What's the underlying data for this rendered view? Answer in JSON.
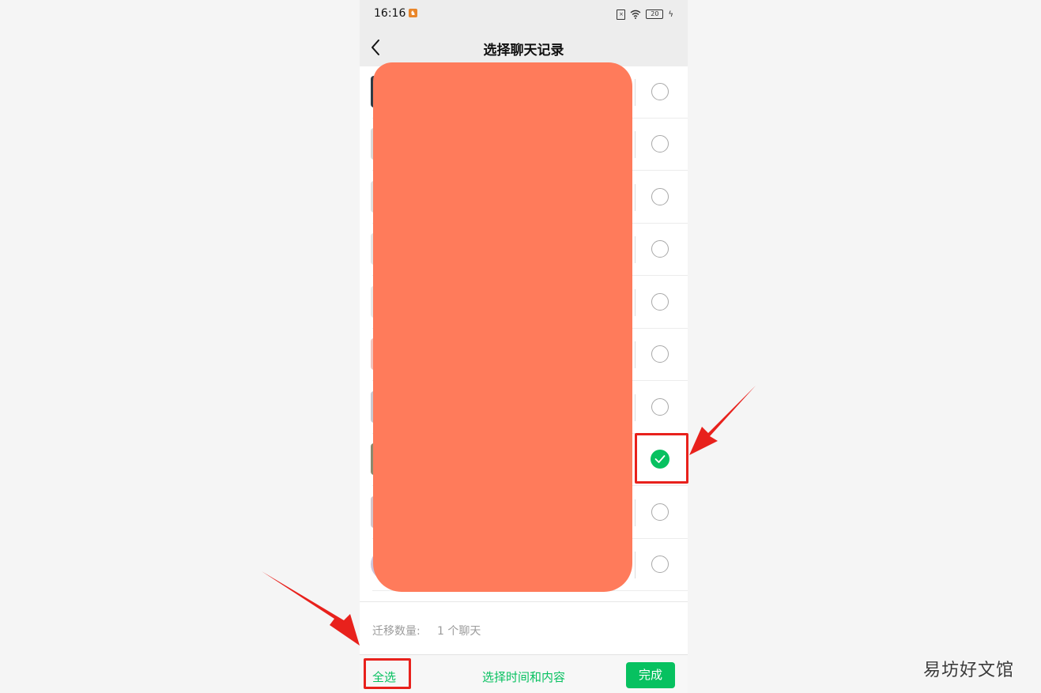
{
  "status_bar": {
    "time": "16:16",
    "battery": "20"
  },
  "header": {
    "title": "选择聊天记录"
  },
  "list": {
    "rows": [
      {
        "selected": false
      },
      {
        "selected": false
      },
      {
        "selected": false
      },
      {
        "selected": false
      },
      {
        "selected": false
      },
      {
        "selected": false
      },
      {
        "selected": false
      },
      {
        "selected": true
      },
      {
        "selected": false
      },
      {
        "selected": false
      }
    ]
  },
  "summary": {
    "label": "迁移数量:",
    "value": "1 个聊天"
  },
  "footer": {
    "select_all": "全选",
    "select_time": "选择时间和内容",
    "done": "完成"
  },
  "watermark": "易坊好文馆",
  "colors": {
    "accent": "#07c160",
    "highlight": "#e8211c",
    "redaction": "#ff7b5b"
  }
}
